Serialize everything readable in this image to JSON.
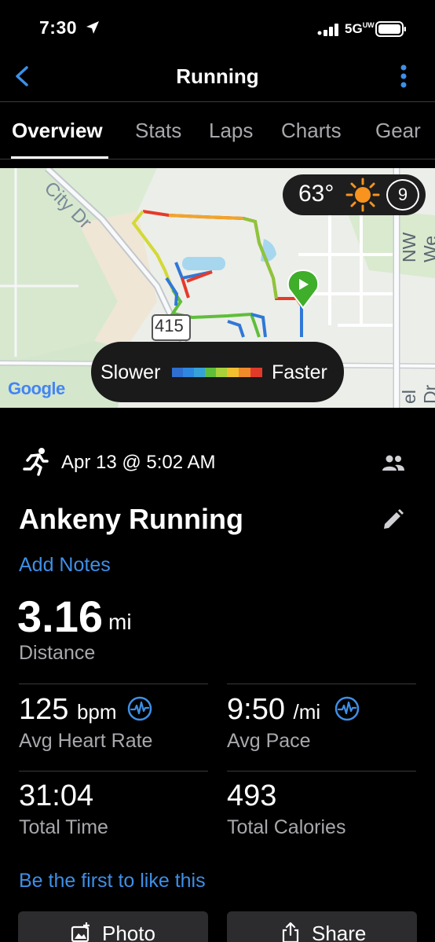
{
  "status_bar": {
    "time": "7:30",
    "network": "5G",
    "network_sup": "UW"
  },
  "nav": {
    "title": "Running"
  },
  "tabs": [
    {
      "label": "Overview"
    },
    {
      "label": "Stats"
    },
    {
      "label": "Laps"
    },
    {
      "label": "Charts"
    },
    {
      "label": "Gear"
    }
  ],
  "map": {
    "temperature": "63°",
    "weather_icon": "sun-icon",
    "zoom_badge": "9",
    "street_city": "City Dr",
    "street_nw": "NW We",
    "street_el": "el Dr",
    "road_shield": "415",
    "legend_slower": "Slower",
    "legend_faster": "Faster",
    "google_logo": "Google",
    "colors": {
      "slow": "#2f78d8",
      "medium": "#6cc23a",
      "fast": "#e23a2a",
      "start_marker": "#3fae2a"
    }
  },
  "activity": {
    "icon": "running-icon",
    "date": "Apr 13 @ 5:02 AM",
    "title": "Ankeny Running",
    "add_notes": "Add Notes",
    "distance_value": "3.16",
    "distance_unit": "mi",
    "distance_label": "Distance"
  },
  "stats": {
    "heart_rate": {
      "value": "125",
      "unit": "bpm",
      "label": "Avg Heart Rate"
    },
    "pace": {
      "value": "9:50",
      "unit": "/mi",
      "label": "Avg Pace"
    },
    "time": {
      "value": "31:04",
      "label": "Total Time"
    },
    "calories": {
      "value": "493",
      "label": "Total Calories"
    }
  },
  "social": {
    "like_link": "Be the first to like this"
  },
  "actions": {
    "photo": "Photo",
    "share": "Share"
  },
  "colors": {
    "accent": "#3e8fe6",
    "background": "#000000",
    "secondary_text": "#a8a8ad",
    "button_bg": "#2c2c2e"
  }
}
